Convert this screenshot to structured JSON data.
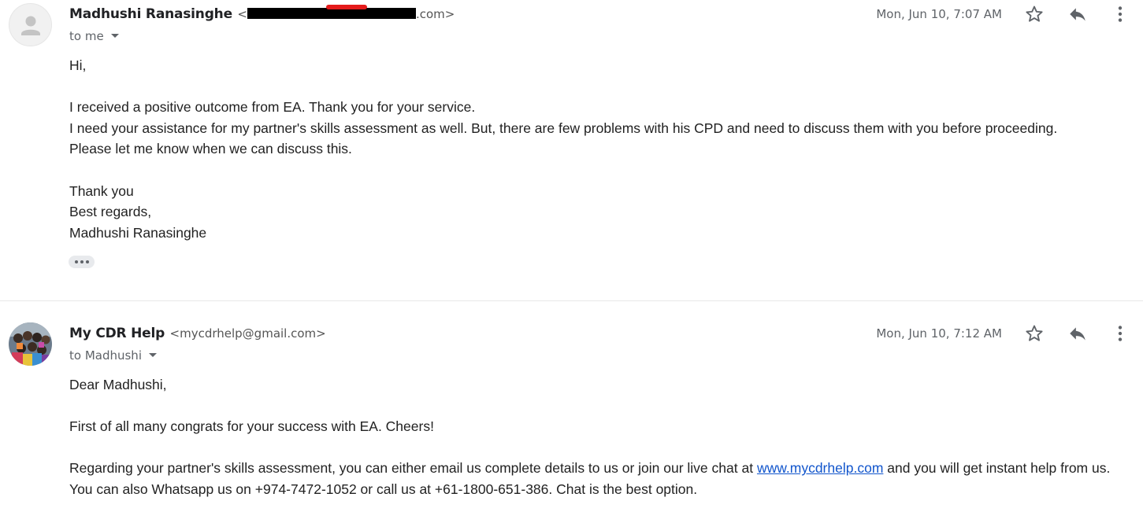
{
  "messages": [
    {
      "sender_name": "Madhushi Ranasinghe",
      "sender_email_prefix": "<",
      "sender_email_suffix": ".com>",
      "recipient": "to me",
      "date": "Mon, Jun 10, 7:07 AM",
      "avatar_icon": "default-person-avatar",
      "body": {
        "greeting": "Hi,",
        "line1": "I received a positive outcome from EA. Thank you for your service.",
        "line2": "I need your assistance for my partner's skills assessment as well. But, there are few problems with his CPD and need to discuss them with you before proceeding.",
        "line3": "Please let me know when we can discuss this.",
        "closing1": "Thank you",
        "closing2": "Best regards,",
        "signature": "Madhushi Ranasinghe"
      }
    },
    {
      "sender_name": "My CDR Help",
      "sender_email": "<mycdrhelp@gmail.com>",
      "recipient": "to Madhushi",
      "date": "Mon, Jun 10, 7:12 AM",
      "avatar_icon": "group-photo-avatar",
      "body": {
        "greeting": "Dear Madhushi,",
        "line1": "First of all many congrats for your success with EA. Cheers!",
        "line2_before": "Regarding your partner's skills assessment, you can either email us complete details to us or join our live chat at ",
        "link": "www.mycdrhelp.com",
        "line2_after": " and you will get instant help from us.",
        "line3": "You can also Whatsapp us on +974-7472-1052 or call us at +61-1800-651-386. Chat is the best option."
      }
    }
  ],
  "icons": {
    "star": "star-outline-icon",
    "reply": "reply-icon",
    "more": "more-vert-icon",
    "ellipsis": "show-trimmed-content-icon"
  },
  "colors": {
    "link": "#1155cc",
    "meta_text": "#5f6368",
    "body_text": "#222222"
  }
}
